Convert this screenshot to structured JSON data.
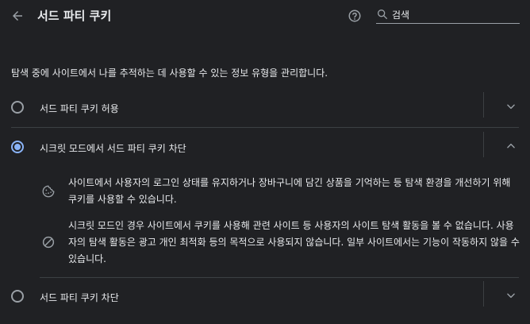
{
  "header": {
    "title": "서드 파티 쿠키",
    "search": {
      "value": "검색",
      "placeholder": "검색"
    },
    "icons": {
      "back": "arrow-back-icon",
      "help": "help-circle-icon",
      "search": "search-icon"
    }
  },
  "description": "탐색 중에 사이트에서 나를 추적하는 데 사용할 수 있는 정보 유형을 관리합니다.",
  "options": [
    {
      "label": "서드 파티 쿠키 허용",
      "selected": false,
      "expanded": false
    },
    {
      "label": "시크릿 모드에서 서드 파티 쿠키 차단",
      "selected": true,
      "expanded": true
    },
    {
      "label": "서드 파티 쿠키 차단",
      "selected": false,
      "expanded": false
    }
  ],
  "details": [
    {
      "icon": "cookie-icon",
      "text": "사이트에서 사용자의 로그인 상태를 유지하거나 장바구니에 담긴 상품을 기억하는 등 탐색 환경을 개선하기 위해 쿠키를 사용할 수 있습니다."
    },
    {
      "icon": "block-icon",
      "text": "시크릿 모드인 경우 사이트에서 쿠키를 사용해 관련 사이트 등 사용자의 사이트 탐색 활동을 볼 수 없습니다. 사용자의 탐색 활동은 광고 개인 최적화 등의 목적으로 사용되지 않습니다. 일부 사이트에서는 기능이 작동하지 않을 수 있습니다."
    }
  ],
  "colors": {
    "background": "#202124",
    "text": "#e8eaed",
    "accent": "#8ab4f8",
    "muted": "#9aa0a6",
    "divider": "#3c4043"
  }
}
